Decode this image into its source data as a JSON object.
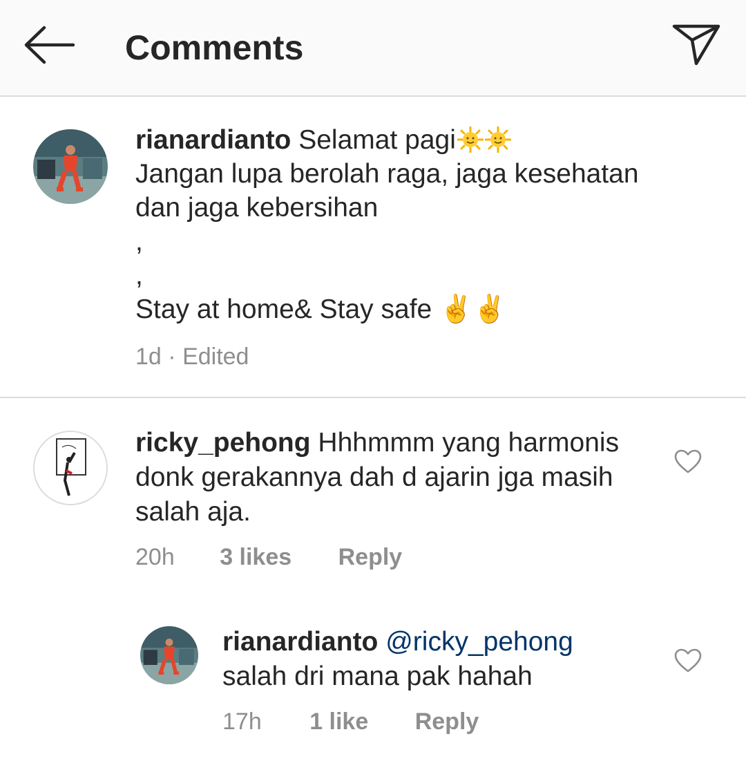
{
  "header": {
    "title": "Comments"
  },
  "icons": {
    "back": "back-arrow-icon",
    "send": "send-direct-icon",
    "heart": "heart-outline-icon",
    "sun": "sun-face-emoji"
  },
  "colors": {
    "header_bg": "#fafafa",
    "text": "#262626",
    "muted": "#8e8e8e",
    "mention": "#003569",
    "divider": "#dbdbdb"
  },
  "caption": {
    "username": "rianardianto",
    "line1_text": "Selamat pagi",
    "line2": "Jangan lupa berolah raga, jaga kesehatan",
    "line3": "dan jaga kebersihan",
    "line4": ",",
    "line5": ",",
    "line6": "Stay at home& Stay safe ✌️✌️",
    "time": "1d",
    "separator": "·",
    "edited": "Edited"
  },
  "comments": [
    {
      "username": "ricky_pehong",
      "line1": "Hhhmmm yang harmonis",
      "line2": "donk gerakannya dah d ajarin jga masih",
      "line3": "salah aja.",
      "time": "20h",
      "likes": "3 likes",
      "reply": "Reply"
    },
    {
      "username": "rianardianto",
      "mention": "@ricky_pehong",
      "line2": "salah dri mana pak hahah",
      "time": "17h",
      "likes": "1 like",
      "reply": "Reply"
    }
  ]
}
